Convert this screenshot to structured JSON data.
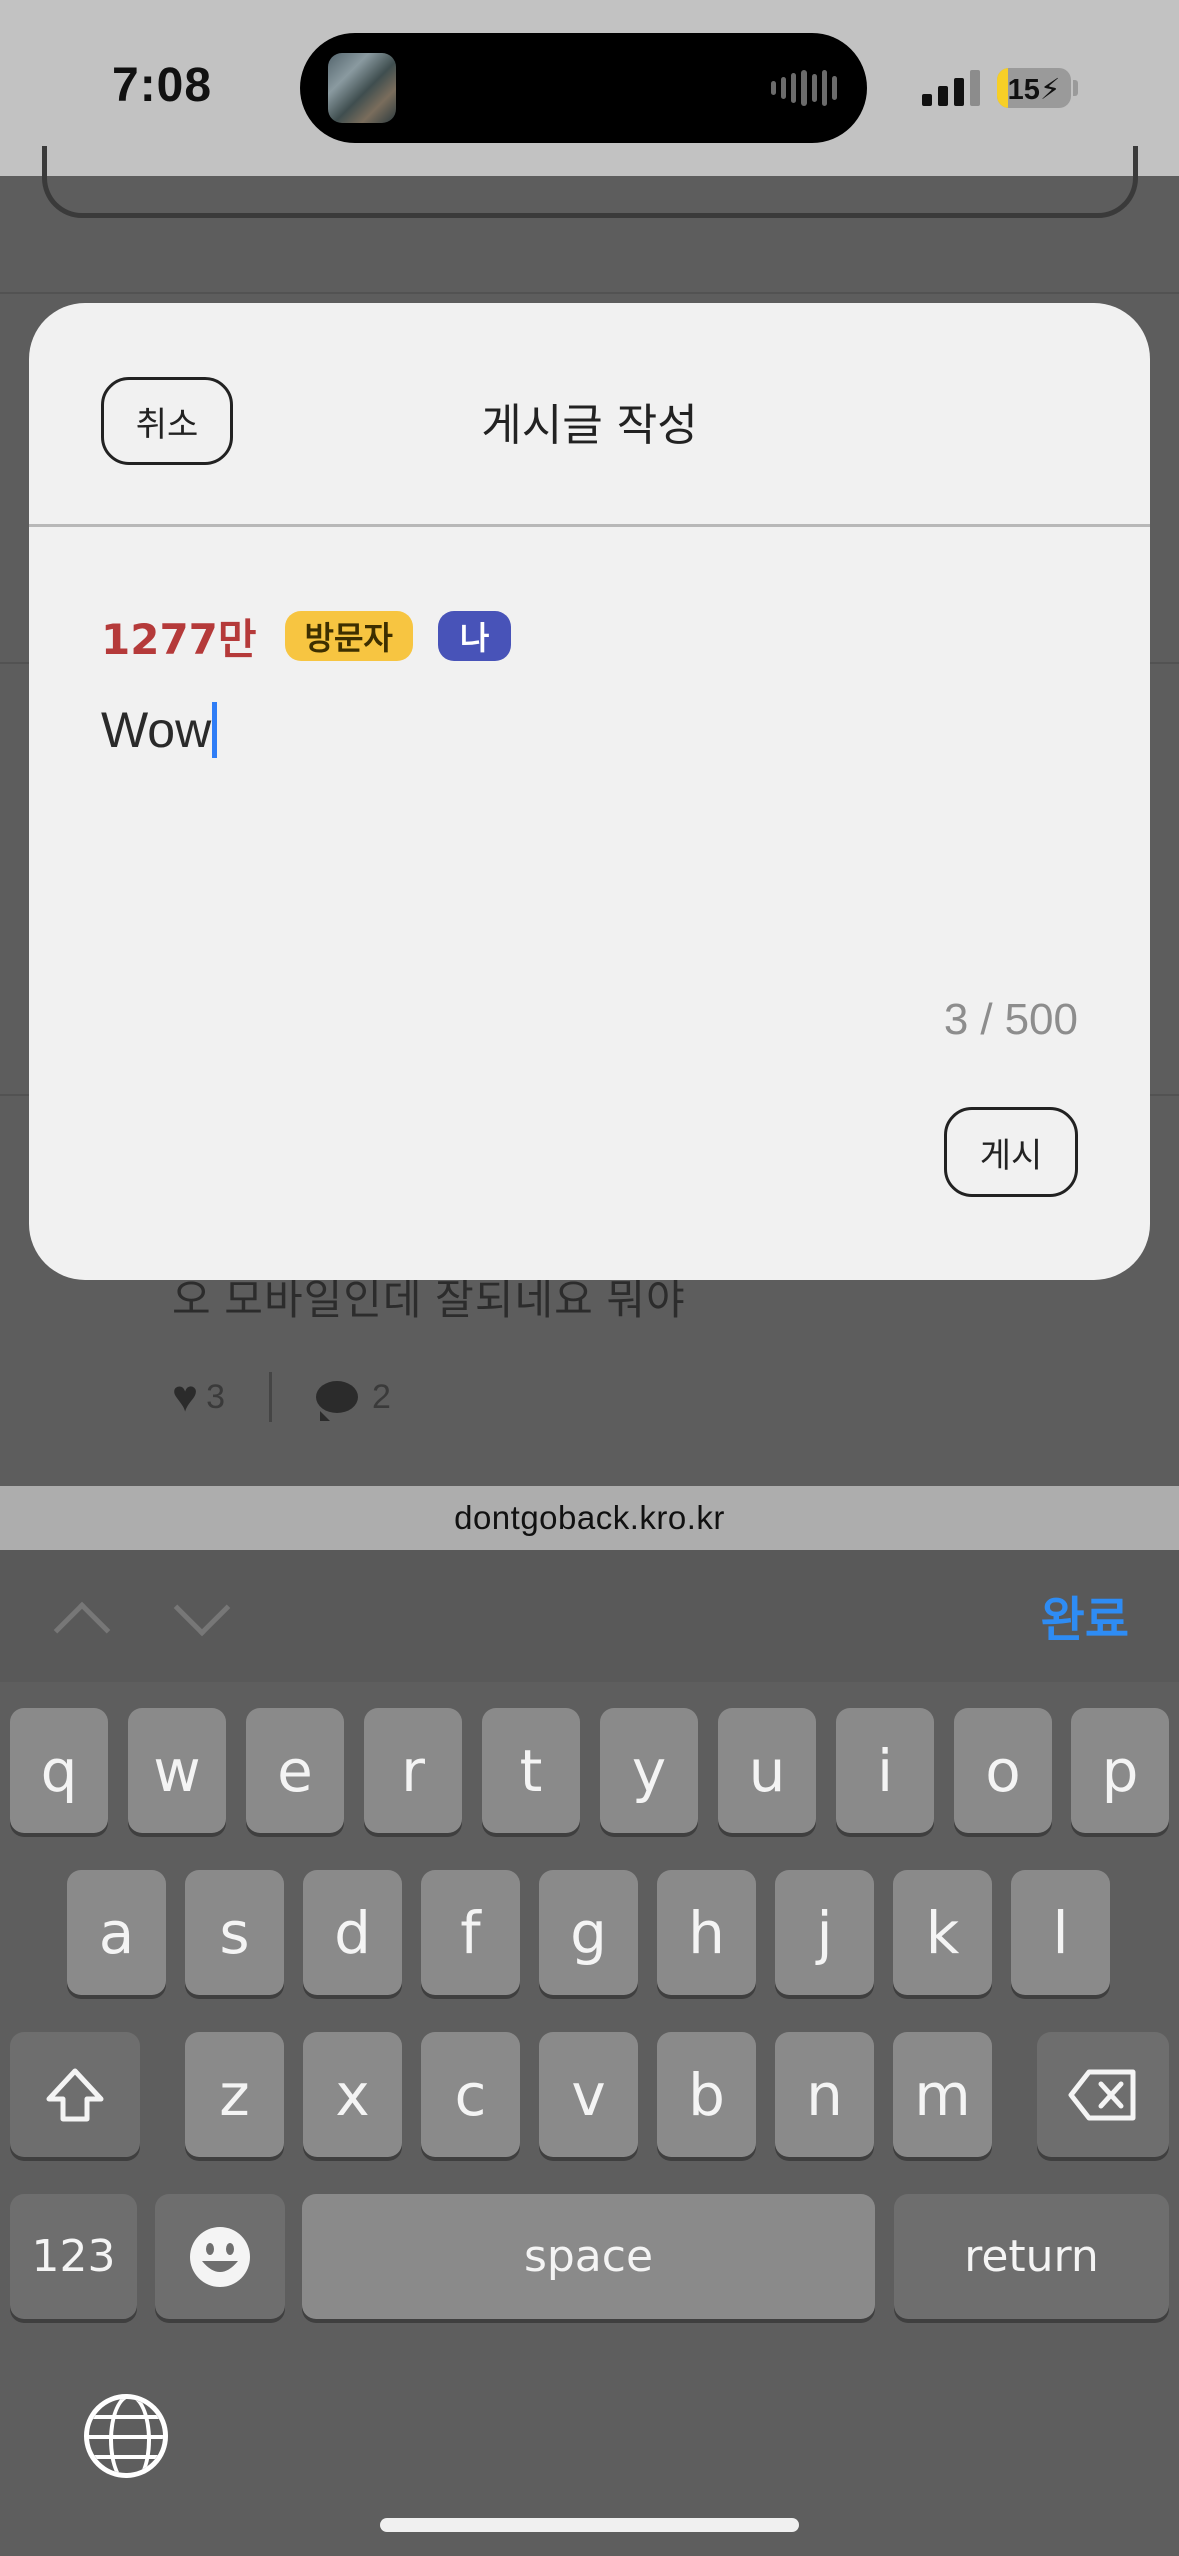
{
  "status_bar": {
    "time": "7:08",
    "battery_label": "15",
    "battery_level_percent": 15,
    "signal_bars_filled": 3
  },
  "background_post": {
    "text": "오 모바일인데 잘되네요 뭐야",
    "likes": "3",
    "comments": "2"
  },
  "modal": {
    "title": "게시글 작성",
    "cancel_label": "취소",
    "post_label": "게시",
    "author": {
      "views": "1277만",
      "visitor_badge": "방문자",
      "me_badge": "나"
    },
    "content": "Wow",
    "char_count": {
      "current": "3",
      "max": "500"
    }
  },
  "browser": {
    "url": "dontgoback.kro.kr"
  },
  "keyboard": {
    "done_label": "완료",
    "row1": [
      "q",
      "w",
      "e",
      "r",
      "t",
      "y",
      "u",
      "i",
      "o",
      "p"
    ],
    "row2": [
      "a",
      "s",
      "d",
      "f",
      "g",
      "h",
      "j",
      "k",
      "l"
    ],
    "row3": [
      "z",
      "x",
      "c",
      "v",
      "b",
      "n",
      "m"
    ],
    "numbers_label": "123",
    "space_label": "space",
    "return_label": "return",
    "emoji_icon": "emoji-icon",
    "shift_icon": "shift-icon",
    "backspace_icon": "backspace-icon",
    "globe_icon": "globe-icon"
  },
  "colors": {
    "accent_blue": "#2e8cf4",
    "views_red": "#b53a3a",
    "visitor_badge": "#f7c541",
    "me_badge": "#4853b8",
    "caret": "#2f7df6"
  }
}
